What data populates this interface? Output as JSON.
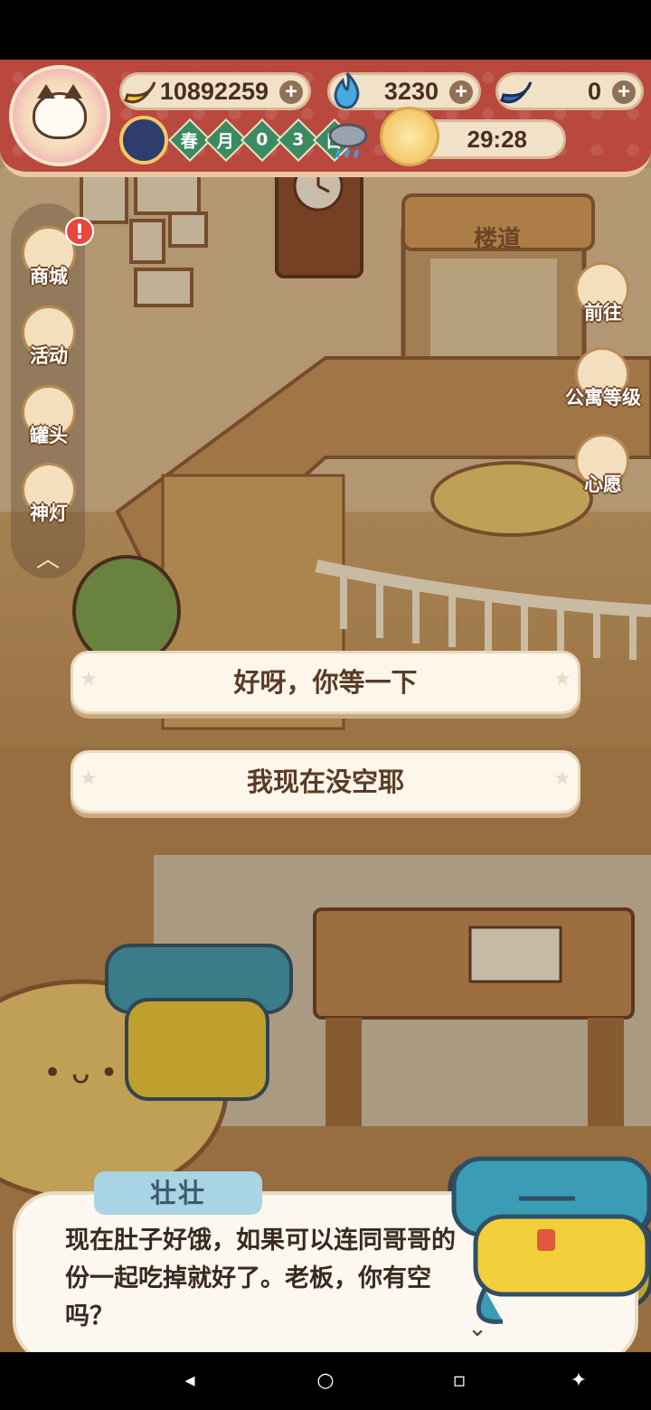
{
  "hud": {
    "banana_currency": "10892259",
    "blue_flame_currency": "3230",
    "blue_banana_currency": "0",
    "season": [
      "春",
      "月",
      "0",
      "3",
      "日"
    ],
    "timer": "29:28",
    "icons": {
      "avatar": "cat-avatar-icon",
      "banana": "banana-icon",
      "flame": "blue-flame-icon",
      "blue_banana": "blue-banana-icon",
      "plus": "plus-icon",
      "clock": "day-night-clock-icon",
      "weather": "rain-cloud-icon",
      "timer": "food-plate-icon"
    }
  },
  "left_menu": {
    "items": [
      {
        "label": "商城",
        "icon": "shop-icon",
        "badge": "!"
      },
      {
        "label": "活动",
        "icon": "gift-icon"
      },
      {
        "label": "罐头",
        "icon": "can-icon"
      },
      {
        "label": "神灯",
        "icon": "magic-lamp-icon"
      }
    ],
    "collapse_icon": "chevron-up-icon"
  },
  "right_menu": {
    "items": [
      {
        "label": "前往",
        "icon": "map-pin-icon"
      },
      {
        "label": "公寓等级",
        "icon": "cat-badge-icon"
      },
      {
        "label": "心愿",
        "icon": "heart-icon"
      }
    ]
  },
  "scene": {
    "sign": "楼道"
  },
  "choices": [
    {
      "label": "好呀，你等一下"
    },
    {
      "label": "我现在没空耶"
    }
  ],
  "dialog": {
    "speaker": "壮壮",
    "text": "现在肚子好饿，如果可以连同哥哥的份一起吃掉就好了。老板，你有空吗？"
  },
  "colors": {
    "banner": "#b9483f",
    "choice_bg": "#fdf6ea",
    "speaker_tag": "#a9d4e4",
    "whale": "#3a9db5"
  }
}
